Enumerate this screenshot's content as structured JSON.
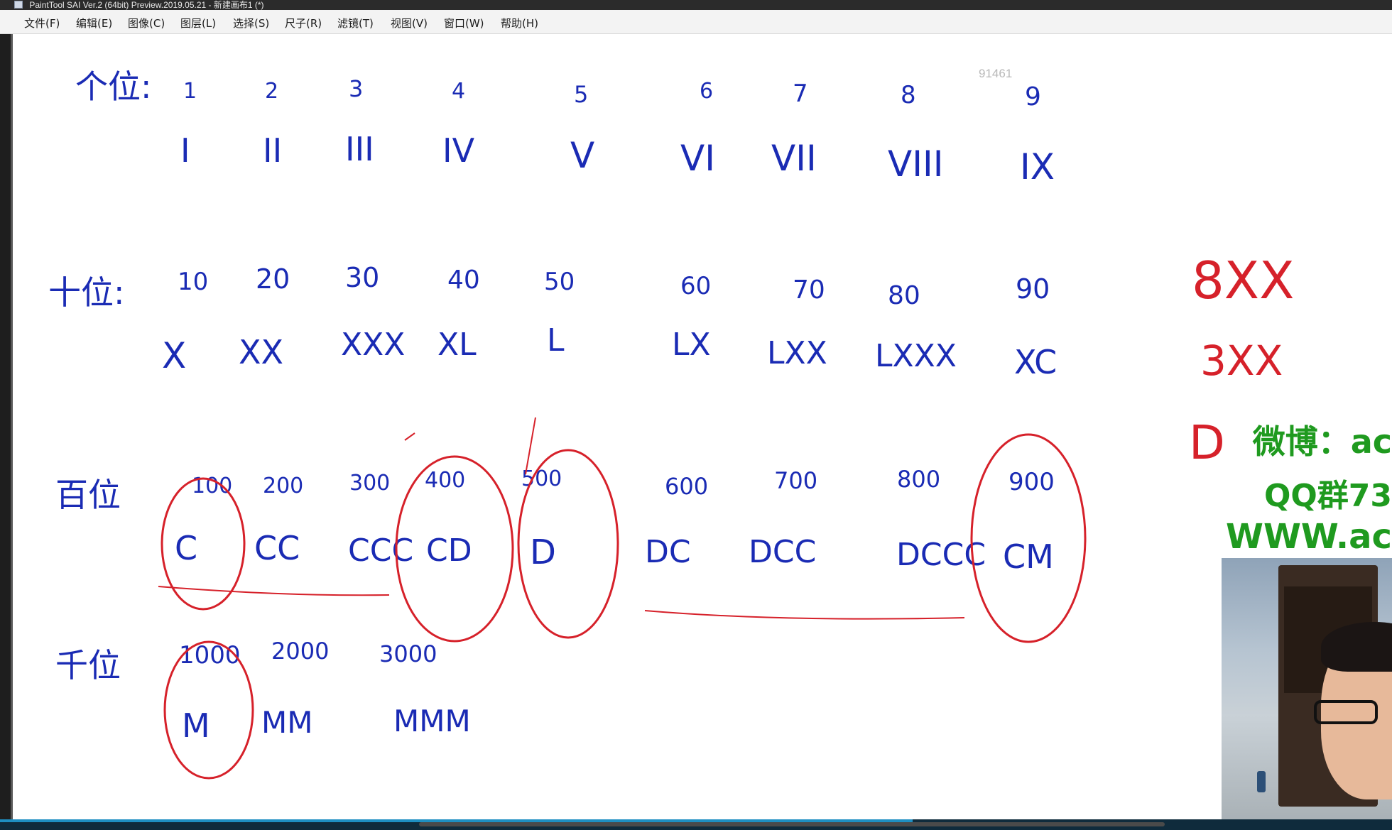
{
  "window": {
    "title": "PaintTool SAI Ver.2 (64bit) Preview.2019.05.21 - 新建画布1 (*)",
    "app_icon": "paint-app-icon"
  },
  "menu": {
    "items": [
      "文件(F)",
      "编辑(E)",
      "图像(C)",
      "图层(L)",
      "选择(S)",
      "尺子(R)",
      "滤镜(T)",
      "视图(V)",
      "窗口(W)",
      "帮助(H)"
    ]
  },
  "canvas": {
    "watermark_number": "91461",
    "rows": [
      {
        "label": "个位:",
        "digits": [
          "1",
          "2",
          "3",
          "4",
          "5",
          "6",
          "7",
          "8",
          "9"
        ],
        "romans": [
          "I",
          "II",
          "III",
          "IV",
          "V",
          "VI",
          "VII",
          "VIII",
          "IX"
        ]
      },
      {
        "label": "十位:",
        "digits": [
          "10",
          "20",
          "30",
          "40",
          "50",
          "60",
          "70",
          "80",
          "90"
        ],
        "romans": [
          "X",
          "XX",
          "XXX",
          "XL",
          "L",
          "LX",
          "LXX",
          "LXXX",
          "XC"
        ]
      },
      {
        "label": "百位",
        "digits": [
          "100",
          "200",
          "300",
          "400",
          "500",
          "600",
          "700",
          "800",
          "900"
        ],
        "romans": [
          "C",
          "CC",
          "CCC",
          "CD",
          "D",
          "DC",
          "DCC",
          "DCCC",
          "CM"
        ]
      },
      {
        "label": "千位",
        "digits": [
          "1000",
          "2000",
          "3000"
        ],
        "romans": [
          "M",
          "MM",
          "MMM"
        ]
      }
    ],
    "red_notes": [
      "8XX",
      "3XX",
      "D"
    ]
  },
  "promo": {
    "weibo": "微博：ac",
    "qq": "QQ群73",
    "site": "WWW.ac"
  },
  "colors": {
    "ink_blue": "#1a2bb4",
    "ink_red": "#d6212a",
    "promo_green": "#1f9a1f"
  }
}
